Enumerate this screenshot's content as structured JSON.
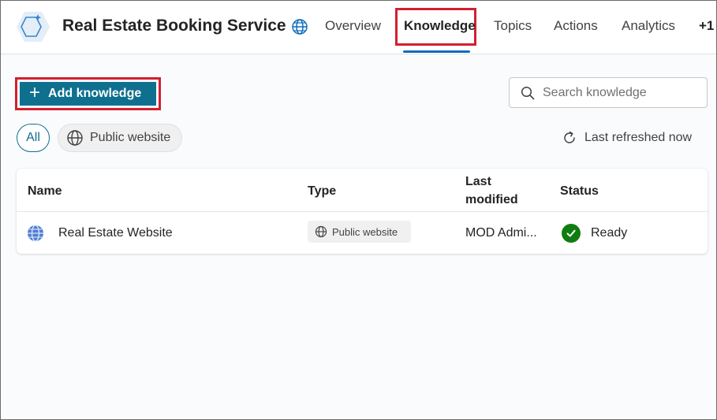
{
  "header": {
    "app_title": "Real Estate Booking Service",
    "tabs": [
      {
        "label": "Overview"
      },
      {
        "label": "Knowledge"
      },
      {
        "label": "Topics"
      },
      {
        "label": "Actions"
      },
      {
        "label": "Analytics"
      },
      {
        "label": "+1"
      }
    ],
    "active_tab": "Knowledge"
  },
  "toolbar": {
    "add_label": "Add knowledge",
    "search_placeholder": "Search knowledge"
  },
  "filters": {
    "all_label": "All",
    "web_label": "Public website",
    "refresh_label": "Last refreshed now"
  },
  "table": {
    "columns": {
      "name": "Name",
      "type": "Type",
      "modified_line1": "Last",
      "modified_line2": "modified",
      "status": "Status"
    },
    "rows": [
      {
        "name": "Real Estate Website",
        "type": "Public website",
        "modified": "MOD Admi...",
        "status": "Ready"
      }
    ]
  },
  "colors": {
    "accent": "#0f6f8f",
    "highlight": "#d12030",
    "ready": "#107c10"
  },
  "icons": [
    "copilot-agent-icon",
    "globe-icon",
    "plus-icon",
    "search-icon",
    "refresh-icon",
    "checkmark-icon"
  ]
}
